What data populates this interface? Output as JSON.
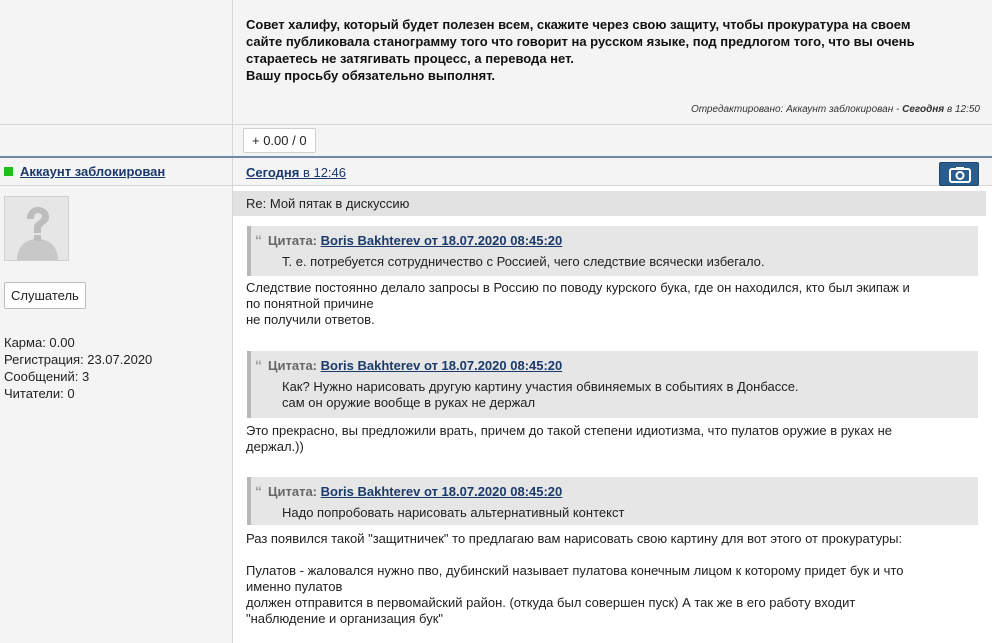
{
  "top_post": {
    "lines": [
      "Совет халифу, который будет полезен всем, скажите через свою защиту, чтобы прокуратура на своем",
      "сайте публиковала станограмму того что говорит на русском языке, под предлогом того, что вы очень",
      "стараетесь не затягивать процесс, а перевода нет.",
      "Вашу просьбу обязательно выполнят."
    ],
    "edited_prefix": "Отредактировано: Аккаунт заблокирован - ",
    "edited_day": "Сегодня",
    "edited_time": " в 12:50"
  },
  "rating": {
    "label": "+ 0.00 / 0"
  },
  "author": {
    "name": "Аккаунт заблокирован",
    "role_button": "Слушатель",
    "stats": [
      "Карма: 0.00",
      "Регистрация: 23.07.2020",
      "Сообщений: 3",
      "Читатели: 0"
    ]
  },
  "post": {
    "date_day": "Сегодня",
    "date_time": " в 12:46",
    "subject": "Re: Мой пятак в дискуссию",
    "quote_label": "Цитата:",
    "quotes": [
      {
        "source": "Boris Bakhterev от 18.07.2020 08:45:20",
        "lines": [
          "Т. е. потребуется сотрудничество с Россией, чего следствие всячески избегало."
        ]
      },
      {
        "source": "Boris Bakhterev от 18.07.2020 08:45:20",
        "lines": [
          "Как? Нужно нарисовать другую картину участия обвиняемых в событиях в Донбассе.",
          "сам он оружие вообще в руках не держал"
        ]
      },
      {
        "source": "Boris Bakhterev от 18.07.2020 08:45:20",
        "lines": [
          "Надо попробовать нарисовать альтернативный контекст"
        ]
      }
    ],
    "paragraphs": [
      [
        "Следствие постоянно делало запросы в Россию по поводу курского бука, где он находился, кто был экипаж и",
        "по понятной причине",
        "не получили ответов."
      ],
      [
        "Это прекрасно, вы предложили врать, причем до такой степени идиотизма, что пулатов оружие в руках не",
        "держал.))"
      ],
      [
        "Раз появился такой \"защитничек\" то предлагаю вам нарисовать свою картину для вот этого от прокуратуры:",
        "",
        "Пулатов - жаловался нужно пво, дубинский называет пулатова конечным лицом к которому придет бук и что",
        "именно пулатов",
        "должен отправится в первомайский район. (откуда был совершен пуск) А так же в его работу входит",
        "\"наблюдение и организация бук\""
      ]
    ]
  },
  "colors": {
    "link": "#1a3a6b",
    "online": "#22bb22",
    "camera_button": "#2b5d8c",
    "divider": "#6f8aa8"
  },
  "icons": {
    "camera": "camera-icon",
    "avatar": "avatar-placeholder-icon",
    "quote": "quote-mark-icon",
    "online": "online-status-icon"
  }
}
